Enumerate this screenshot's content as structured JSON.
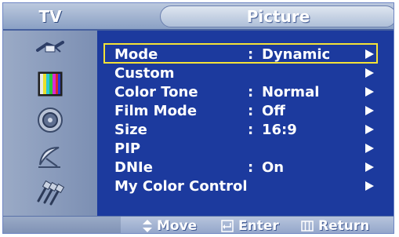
{
  "header": {
    "tv_label": "TV",
    "title": "Picture"
  },
  "sidebar": {
    "items": [
      {
        "icon": "antenna-plug-icon"
      },
      {
        "icon": "color-bars-icon"
      },
      {
        "icon": "speaker-icon"
      },
      {
        "icon": "satellite-dish-icon"
      },
      {
        "icon": "cables-icon"
      }
    ]
  },
  "menu": {
    "rows": [
      {
        "label": "Mode",
        "colon": ":",
        "value": "Dynamic",
        "selected": true
      },
      {
        "label": "Custom",
        "colon": "",
        "value": ""
      },
      {
        "label": "Color Tone",
        "colon": ":",
        "value": "Normal"
      },
      {
        "label": "Film Mode",
        "colon": ":",
        "value": "Off"
      },
      {
        "label": "Size",
        "colon": ":",
        "value": "16:9"
      },
      {
        "label": "PIP",
        "colon": "",
        "value": ""
      },
      {
        "label": "DNIe",
        "colon": ":",
        "value": "On"
      },
      {
        "label": "My Color Control",
        "colon": "",
        "value": ""
      }
    ]
  },
  "footer": {
    "move": "Move",
    "enter": "Enter",
    "return": "Return"
  },
  "colors": {
    "background": "#1c3a9e",
    "highlight": "#f4e237",
    "text": "#ffffff"
  }
}
